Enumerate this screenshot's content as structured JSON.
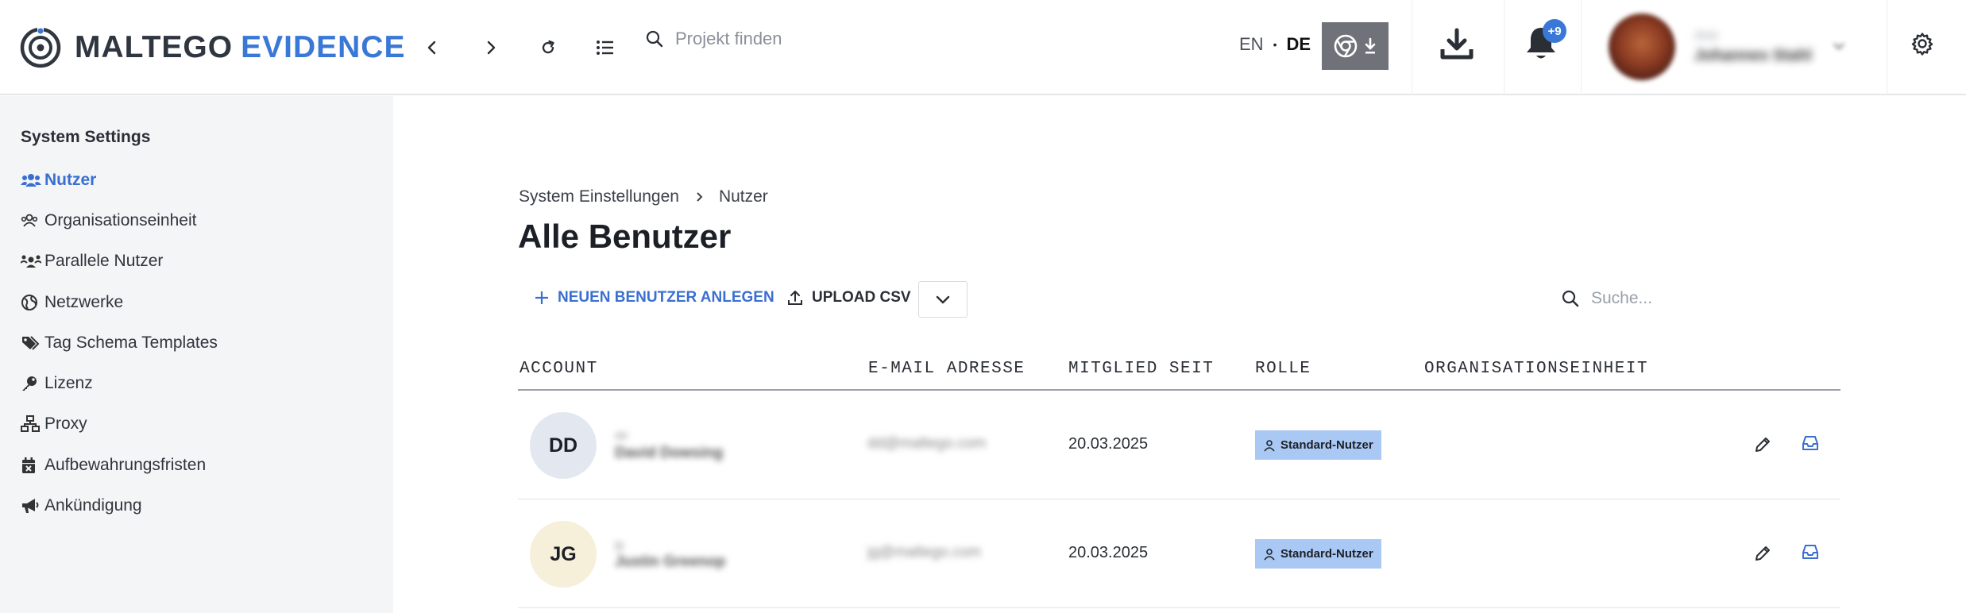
{
  "header": {
    "logo_part1": "MALTEGO",
    "logo_part2": "EVIDENCE",
    "search_placeholder": "Projekt finden",
    "lang_en": "EN",
    "lang_separator": "•",
    "lang_de": "DE",
    "notification_badge": "+9",
    "user_small": "Ansi",
    "user_name": "Johannes Stahl"
  },
  "sidebar": {
    "title": "System Settings",
    "items": [
      {
        "label": "Nutzer",
        "icon": "users-icon",
        "active": true
      },
      {
        "label": "Organisationseinheit",
        "icon": "org-unit-icon",
        "active": false
      },
      {
        "label": "Parallele Nutzer",
        "icon": "parallel-users-icon",
        "active": false
      },
      {
        "label": "Netzwerke",
        "icon": "globe-icon",
        "active": false
      },
      {
        "label": "Tag Schema Templates",
        "icon": "tags-icon",
        "active": false
      },
      {
        "label": "Lizenz",
        "icon": "key-icon",
        "active": false
      },
      {
        "label": "Proxy",
        "icon": "network-icon",
        "active": false
      },
      {
        "label": "Aufbewahrungsfristen",
        "icon": "calendar-x-icon",
        "active": false
      },
      {
        "label": "Ankündigung",
        "icon": "megaphone-icon",
        "active": false
      }
    ]
  },
  "main": {
    "breadcrumb": [
      "System Einstellungen",
      "Nutzer"
    ],
    "title": "Alle Benutzer",
    "actions": {
      "new_user": "NEUEN BENUTZER ANLEGEN",
      "upload_csv": "UPLOAD CSV"
    },
    "search_placeholder": "Suche...",
    "columns": [
      "ACCOUNT",
      "E-MAIL ADRESSE",
      "MITGLIED SEIT",
      "ROLLE",
      "ORGANISATIONSEINHEIT"
    ],
    "rows": [
      {
        "initials": "DD",
        "avatar_color": "#e3e8f0",
        "account_small": "dd",
        "account_name": "David Dowsing",
        "email": "dd@maltego.com",
        "member_since": "20.03.2025",
        "role": "Standard-Nutzer",
        "org_unit": ""
      },
      {
        "initials": "JG",
        "avatar_color": "#f6efda",
        "account_small": "jg",
        "account_name": "Justin Greenop",
        "email": "jg@maltego.com",
        "member_since": "20.03.2025",
        "role": "Standard-Nutzer",
        "org_unit": ""
      }
    ]
  },
  "colors": {
    "accent": "#3a78d8",
    "role_badge": "#aac8f4",
    "sidebar_bg": "#f4f5f7"
  }
}
